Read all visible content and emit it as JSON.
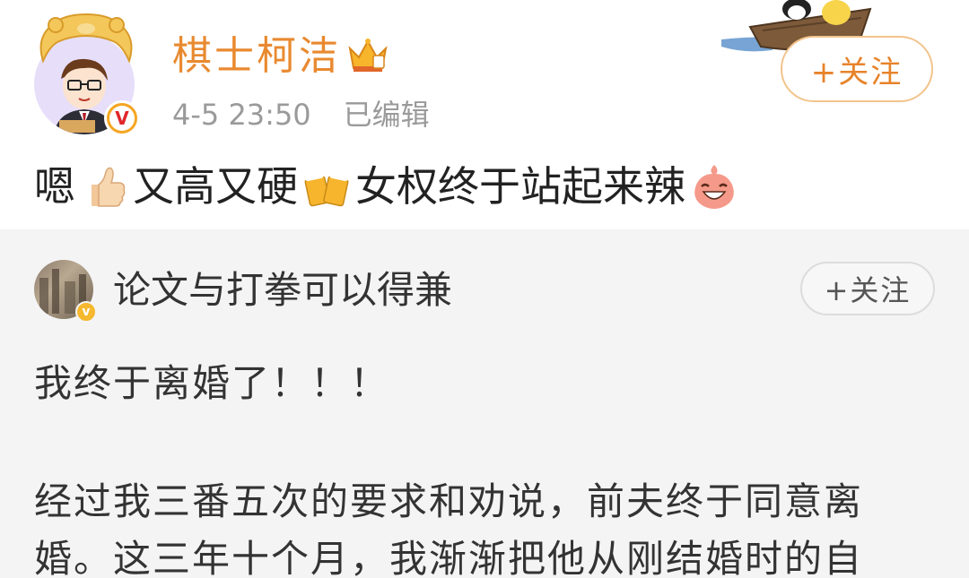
{
  "post": {
    "username": "棋士柯洁",
    "time": "4-5 23:50",
    "edited": "已编辑",
    "follow_label": "+关注",
    "text": {
      "part1": "嗯",
      "part2": "又高又硬",
      "part3": "女权终于站起来辣"
    },
    "emojis": [
      "thumbs-up-icon",
      "beer-cheers-icon",
      "laughing-face-icon"
    ]
  },
  "repost": {
    "username": "论文与打拳可以得兼",
    "follow_label": "+关注",
    "lines": [
      "我终于离婚了！！！",
      "经过我三番五次的要求和劝说，前夫终于同意离",
      "婚。这三年十个月，我渐渐把他从刚结婚时的自"
    ]
  },
  "colors": {
    "username": "#e9892f",
    "follow_text": "#e7832a",
    "follow_border": "#f2c48c",
    "repost_bg": "#f4f4f4",
    "meta_gray": "#9a9a9a"
  }
}
